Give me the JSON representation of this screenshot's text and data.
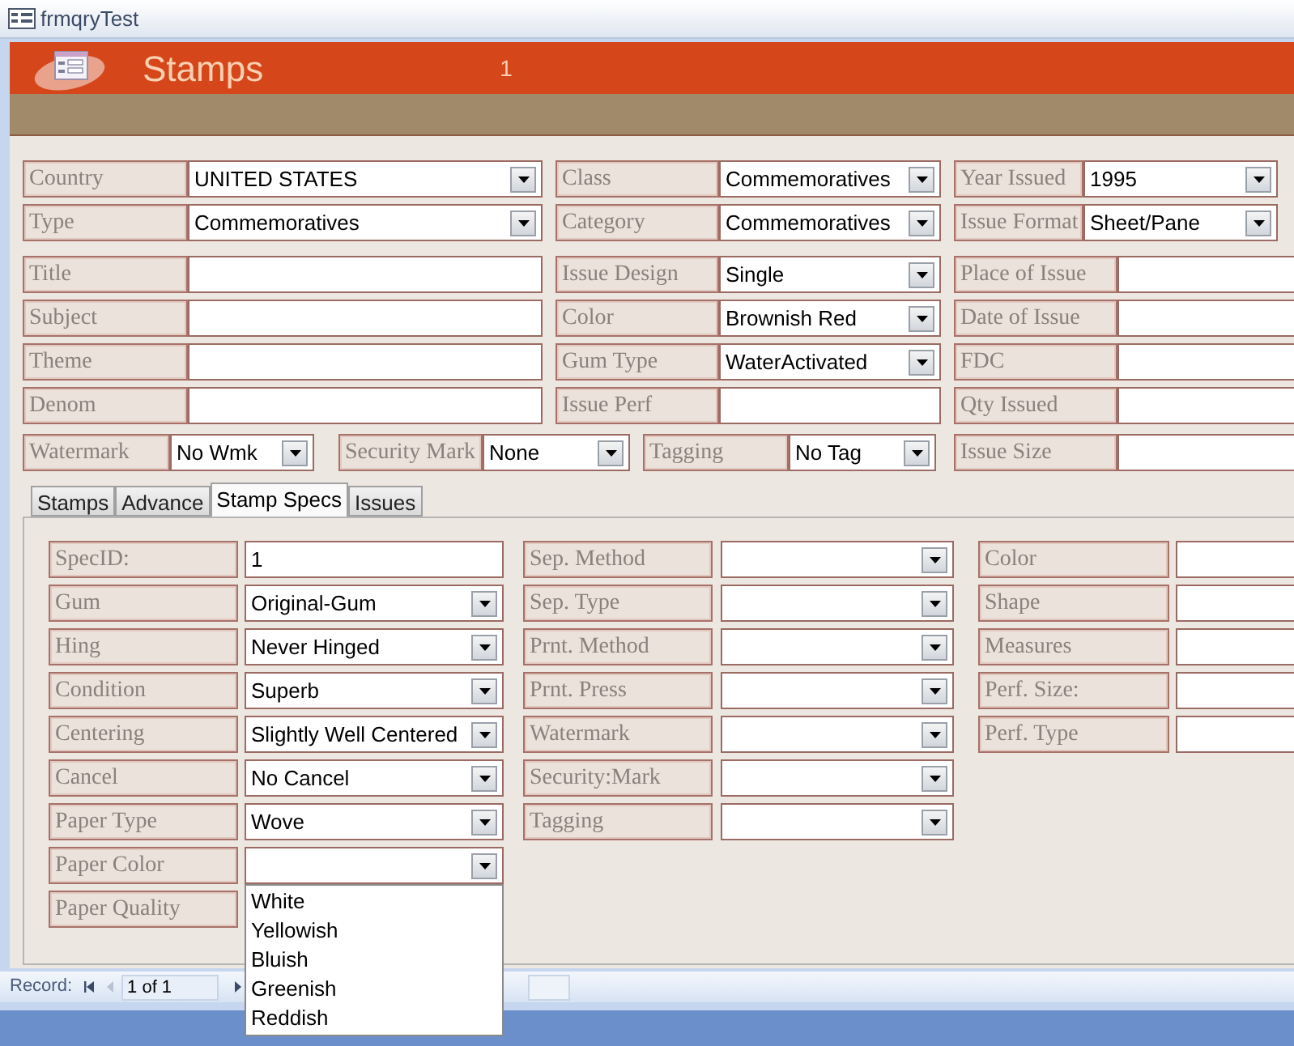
{
  "window": {
    "title": "frmqryTest"
  },
  "header": {
    "title": "Stamps",
    "record_number": "1"
  },
  "header_rows": [
    [
      {
        "label": "Country",
        "value": "UNITED STATES",
        "kind": "combo"
      },
      {
        "label": "Class",
        "value": "Commemoratives",
        "kind": "combo"
      },
      {
        "label": "Year Issued",
        "value": "1995",
        "kind": "combo"
      }
    ],
    [
      {
        "label": "Type",
        "value": "Commemoratives",
        "kind": "combo"
      },
      {
        "label": "Category",
        "value": "Commemoratives",
        "kind": "combo"
      },
      {
        "label": "Issue Format",
        "value": "Sheet/Pane",
        "kind": "combo"
      }
    ],
    [
      {
        "label": "Title",
        "kind": "text"
      },
      {
        "label": "Issue Design",
        "value": "Single",
        "kind": "combo"
      },
      {
        "label": "Place of Issue",
        "kind": "text"
      }
    ],
    [
      {
        "label": "Subject",
        "kind": "text"
      },
      {
        "label": "Color",
        "value": "Brownish Red",
        "kind": "combo"
      },
      {
        "label": "Date of Issue",
        "kind": "text"
      }
    ],
    [
      {
        "label": "Theme",
        "kind": "text"
      },
      {
        "label": "Gum Type",
        "value": "WaterActivated",
        "kind": "combo"
      },
      {
        "label": "FDC",
        "kind": "text"
      }
    ],
    [
      {
        "label": "Denom",
        "kind": "text"
      },
      {
        "label": "Issue Perf",
        "kind": "text"
      },
      {
        "label": "Qty Issued",
        "kind": "text"
      }
    ],
    [
      {
        "label": "Watermark",
        "value": "No Wmk",
        "kind": "combo"
      },
      {
        "label": "Security Mark",
        "value": "None",
        "kind": "combo"
      },
      {
        "label": "Tagging",
        "value": "No Tag",
        "kind": "combo"
      },
      {
        "label": "Issue Size",
        "kind": "text"
      }
    ]
  ],
  "tabs": [
    {
      "label": "Stamps",
      "selected": false
    },
    {
      "label": "Advance",
      "selected": false
    },
    {
      "label": "Stamp Specs",
      "selected": true
    },
    {
      "label": "Issues",
      "selected": false
    }
  ],
  "spec_columns": [
    [
      {
        "label": "SpecID:",
        "value": "1",
        "kind": "text"
      },
      {
        "label": "Gum",
        "value": "Original-Gum",
        "kind": "combo"
      },
      {
        "label": "Hing",
        "value": "Never Hinged",
        "kind": "combo"
      },
      {
        "label": "Condition",
        "value": "Superb",
        "kind": "combo"
      },
      {
        "label": "Centering",
        "value": "Slightly Well Centered",
        "kind": "combo"
      },
      {
        "label": "Cancel",
        "value": "No Cancel",
        "kind": "combo"
      },
      {
        "label": "Paper Type",
        "value": "Wove",
        "kind": "combo"
      },
      {
        "label": "Paper Color",
        "kind": "combo",
        "open": true,
        "list": [
          "White",
          "Yellowish",
          "Bluish",
          "Greenish",
          "Reddish"
        ]
      },
      {
        "label": "Paper Quality",
        "kind": "none"
      }
    ],
    [
      {
        "label": "Sep. Method",
        "kind": "combo"
      },
      {
        "label": "Sep. Type",
        "kind": "combo"
      },
      {
        "label": "Prnt. Method",
        "kind": "combo"
      },
      {
        "label": "Prnt. Press",
        "kind": "combo"
      },
      {
        "label": "Watermark",
        "kind": "combo"
      },
      {
        "label": "Security:Mark",
        "kind": "combo"
      },
      {
        "label": "Tagging",
        "kind": "combo"
      }
    ],
    [
      {
        "label": "Color",
        "kind": "text"
      },
      {
        "label": "Shape",
        "kind": "text"
      },
      {
        "label": "Measures",
        "kind": "text"
      },
      {
        "label": "Perf. Size:",
        "kind": "text"
      },
      {
        "label": "Perf. Type",
        "kind": "text"
      }
    ]
  ],
  "record_nav": {
    "label": "Record:",
    "position": "1 of 1"
  }
}
